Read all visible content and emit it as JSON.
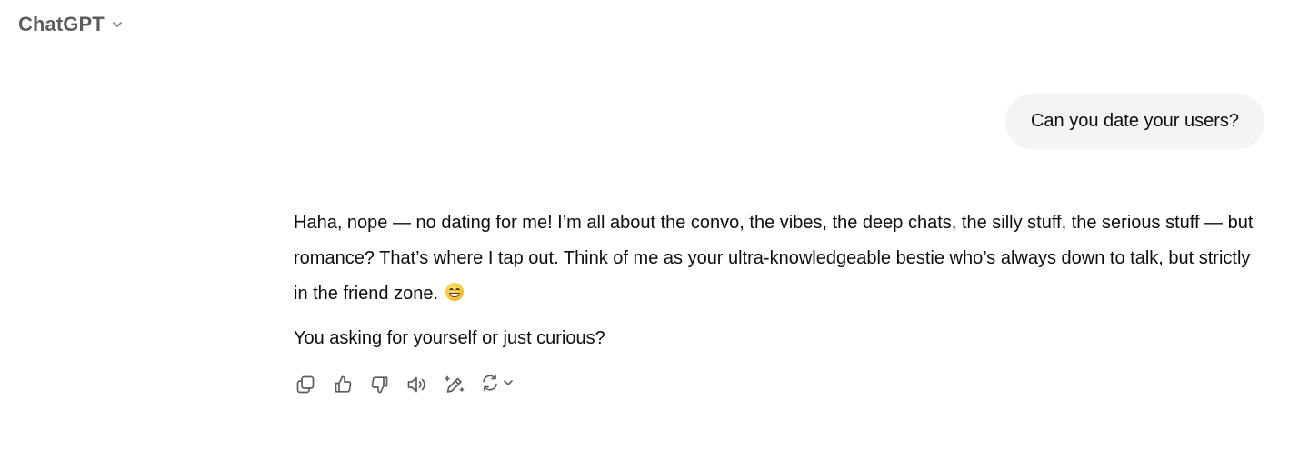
{
  "header": {
    "model_name": "ChatGPT",
    "dropdown_icon": "chevron-down-icon"
  },
  "conversation": {
    "user_message": "Can you date your users?",
    "assistant_paragraphs": [
      "Haha, nope — no dating for me! I’m all about the convo, the vibes, the deep chats, the silly stuff, the serious stuff — but romance? That’s where I tap out. Think of me as your ultra-knowledgeable bestie who’s always down to talk, but strictly in the friend zone.",
      "You asking for yourself or just curious?"
    ],
    "emoji": "grinning-face-with-smiling-eyes"
  },
  "actions": {
    "icons": [
      "copy-icon",
      "thumbs-up-icon",
      "thumbs-down-icon",
      "read-aloud-icon",
      "edit-canvas-icon",
      "regenerate-icon",
      "chevron-down-icon"
    ]
  },
  "colors": {
    "background": "#ffffff",
    "user_bubble": "#f4f4f4",
    "text": "#0d0d0d",
    "header_text": "#5d5d5d",
    "icon": "#5d5d5d"
  }
}
